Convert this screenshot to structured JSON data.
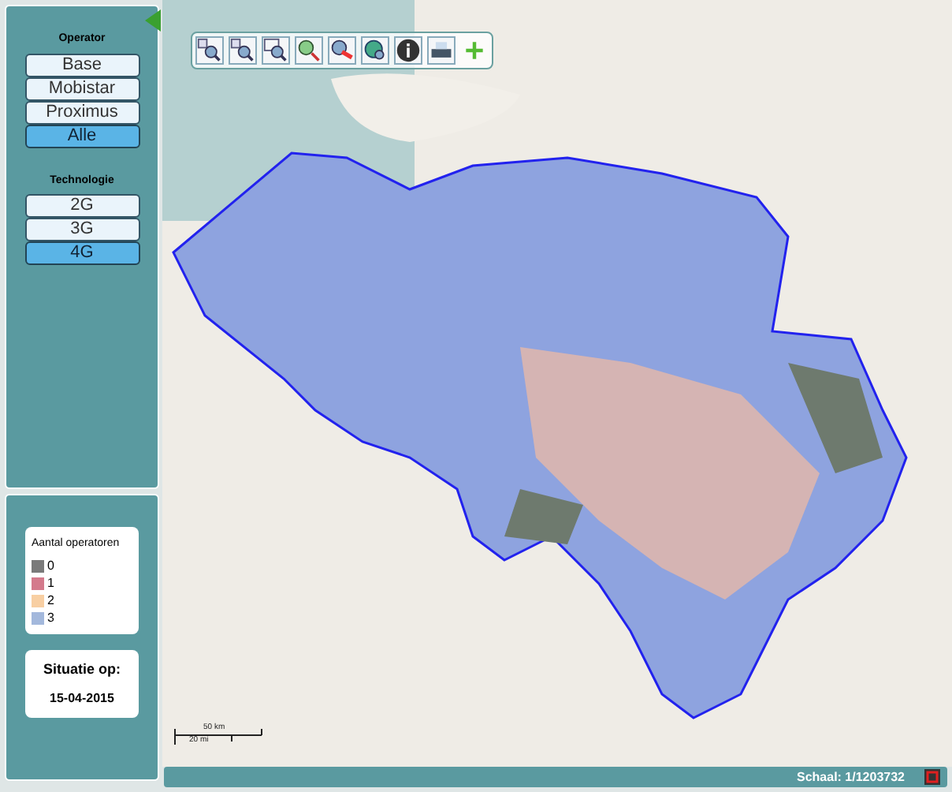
{
  "operator": {
    "title": "Operator",
    "buttons": [
      {
        "label": "Base",
        "selected": false
      },
      {
        "label": "Mobistar",
        "selected": false
      },
      {
        "label": "Proximus",
        "selected": false
      },
      {
        "label": "Alle",
        "selected": true
      }
    ]
  },
  "technologie": {
    "title": "Technologie",
    "buttons": [
      {
        "label": "2G",
        "selected": false
      },
      {
        "label": "3G",
        "selected": false
      },
      {
        "label": "4G",
        "selected": true
      }
    ]
  },
  "legend": {
    "title": "Aantal operatoren",
    "items": [
      {
        "label": "0",
        "color": "#7a7a7a"
      },
      {
        "label": "1",
        "color": "#d47a8c"
      },
      {
        "label": "2",
        "color": "#f8cfa3"
      },
      {
        "label": "3",
        "color": "#a3b8dc"
      }
    ]
  },
  "situatie": {
    "title": "Situatie op:",
    "date": "15-04-2015"
  },
  "scale_bar": {
    "top": "50 km",
    "bottom": "20 mi"
  },
  "status_bar": {
    "scale": "Schaal: 1/1203732"
  }
}
